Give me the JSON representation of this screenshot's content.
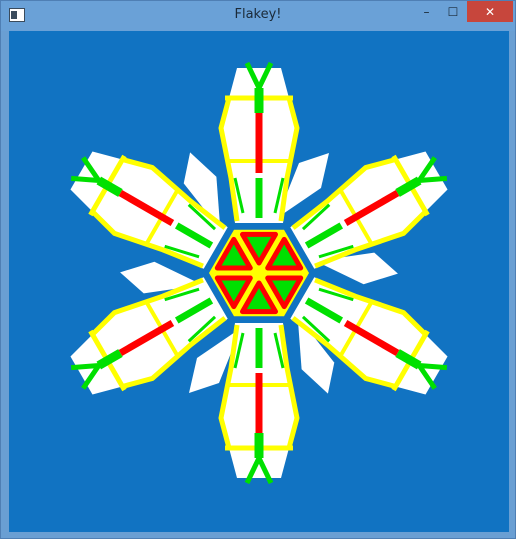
{
  "window": {
    "title": "Flakey!",
    "controls": {
      "minimize_glyph": "–",
      "maximize_glyph": "☐",
      "close_glyph": "✕"
    },
    "icons": {
      "app": "window-app-icon",
      "minimize": "minimize-icon",
      "maximize": "maximize-icon",
      "close": "close-icon"
    }
  },
  "canvas": {
    "content": "snowflake-drawing",
    "arms": 6,
    "colors": {
      "background": "#1173c2",
      "flake_fill": "#ffffff",
      "outline": "#ffff00",
      "spine": "#ff0000",
      "accent": "#00e000"
    }
  }
}
